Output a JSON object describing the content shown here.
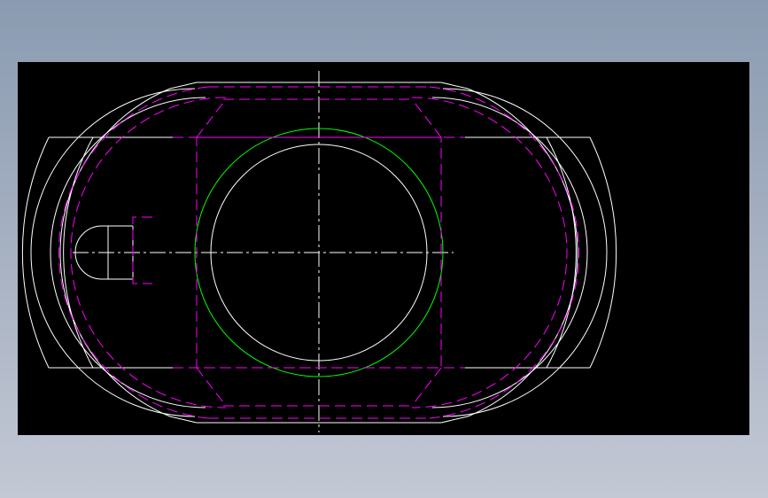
{
  "drawing": {
    "type": "cad-view",
    "colors": {
      "background": "#000000",
      "visible_edges": "#ffffff",
      "hidden_lines": "#ff00ff",
      "pitch_circle": "#00ff00",
      "center_lines": "#ffffff"
    }
  }
}
